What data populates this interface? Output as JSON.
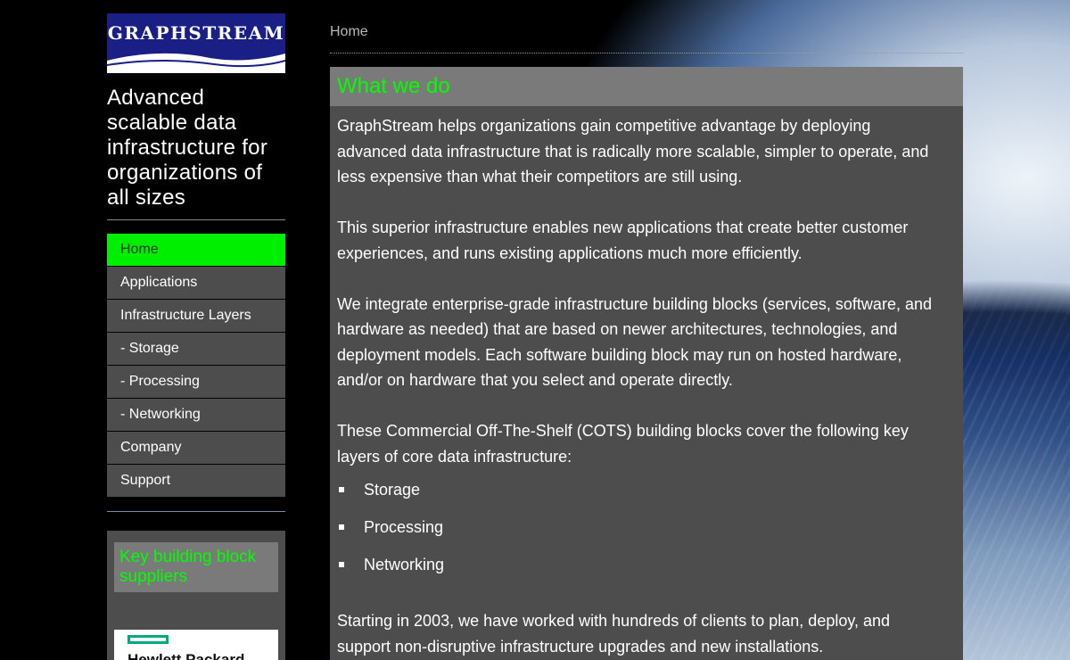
{
  "logo": {
    "text": "GRAPHSTREAM"
  },
  "tagline": "Advanced scalable data infrastructure for organizations of all sizes",
  "nav": {
    "items": [
      {
        "label": "Home",
        "active": true
      },
      {
        "label": "Applications"
      },
      {
        "label": "Infrastructure Layers"
      },
      {
        "label": "- Storage"
      },
      {
        "label": "- Processing"
      },
      {
        "label": "- Networking"
      },
      {
        "label": "Company"
      },
      {
        "label": "Support"
      }
    ]
  },
  "suppliers": {
    "heading": "Key building block suppliers",
    "logo_text": "Hewlett Packard"
  },
  "breadcrumb": "Home",
  "main": {
    "heading": "What we do",
    "paragraphs": [
      "GraphStream helps organizations gain competitive advantage by deploying advanced data infrastructure that is radically more scalable, simpler to operate, and less expensive than what their competitors are still using.",
      "This superior infrastructure enables new applications that create better customer experiences, and runs existing applications much more efficiently.",
      "We integrate enterprise-grade infrastructure building blocks (services, software, and hardware as needed) that are based on newer architectures, technologies, and deployment models. Each software building block may run on hosted hardware, and/or on hardware that you select and operate directly.",
      "These Commercial Off-The-Shelf (COTS) building blocks cover the following key layers of core data infrastructure:"
    ],
    "bullets": [
      "Storage",
      "Processing",
      "Networking"
    ],
    "closing": "Starting in 2003, we have worked with hundreds of clients to plan, deploy, and support non-disruptive infrastructure upgrades and new installations."
  },
  "colors": {
    "accent_green": "#00ee00",
    "panel_gray": "#4d4d4d",
    "header_gray": "#7a7a7a",
    "logo_navy": "#1a1f86"
  }
}
